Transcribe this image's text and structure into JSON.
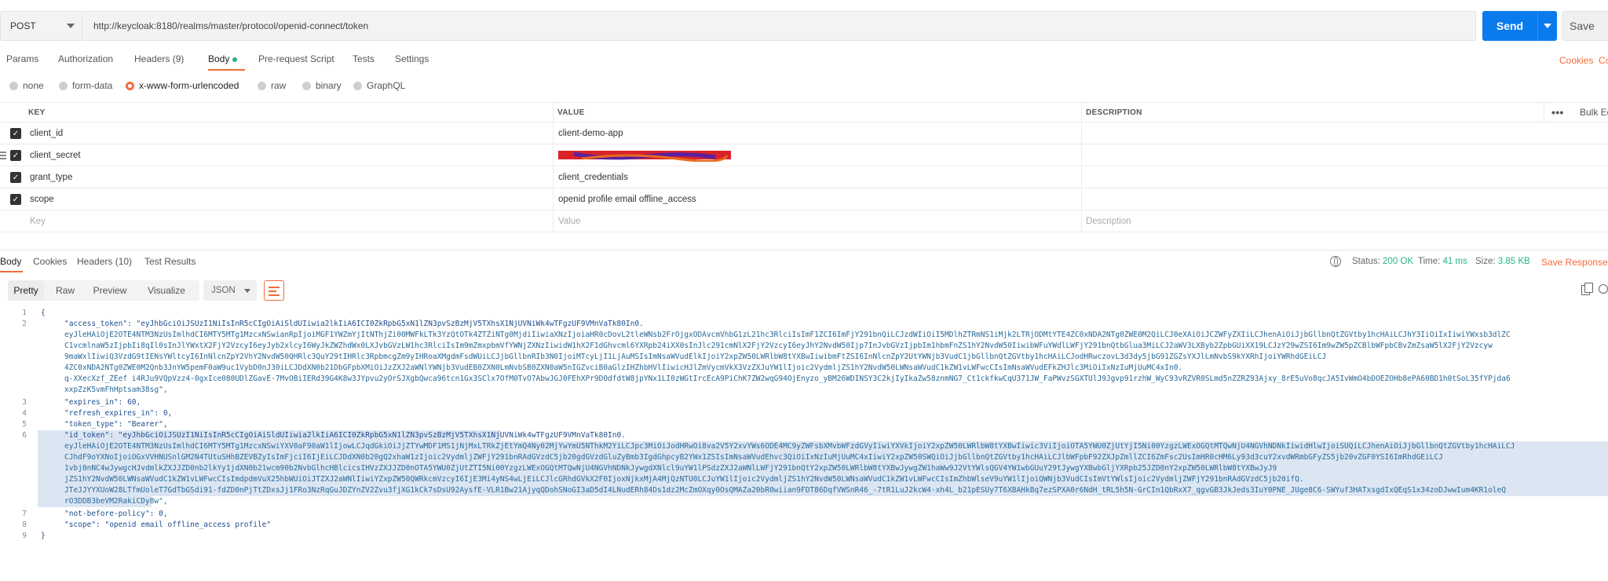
{
  "request": {
    "method": "POST",
    "url": "http://keycloak:8180/realms/master/protocol/openid-connect/token",
    "send_label": "Send",
    "save_label": "Save"
  },
  "request_tabs": {
    "params": "Params",
    "authorization": "Authorization",
    "headers": "Headers (9)",
    "body": "Body",
    "prerequest": "Pre-request Script",
    "tests": "Tests",
    "settings": "Settings",
    "cookies": "Cookies",
    "code": "Co"
  },
  "body_types": [
    "none",
    "form-data",
    "x-www-form-urlencoded",
    "raw",
    "binary",
    "GraphQL"
  ],
  "body_type_selected": "x-www-form-urlencoded",
  "params_table": {
    "headers": {
      "key": "KEY",
      "value": "VALUE",
      "description": "DESCRIPTION",
      "more": "•••",
      "bulk_edit": "Bulk Ed"
    },
    "rows": [
      {
        "key": "client_id",
        "value": "client-demo-app",
        "checked": true
      },
      {
        "key": "client_secret",
        "value": "",
        "checked": true,
        "redacted": true
      },
      {
        "key": "grant_type",
        "value": "client_credentials",
        "checked": true
      },
      {
        "key": "scope",
        "value": "openid profile email offline_access",
        "checked": true
      }
    ],
    "placeholder": {
      "key": "Key",
      "value": "Value",
      "description": "Description"
    }
  },
  "response_tabs": {
    "body": "Body",
    "cookies": "Cookies",
    "headers": "Headers (10)",
    "test_results": "Test Results"
  },
  "response_status": {
    "status_label": "Status:",
    "status_value": "200 OK",
    "time_label": "Time:",
    "time_value": "41 ms",
    "size_label": "Size:",
    "size_value": "3.85 KB",
    "save_response": "Save Response"
  },
  "view_bar": {
    "modes": [
      "Pretty",
      "Raw",
      "Preview",
      "Visualize"
    ],
    "selected": "Pretty",
    "format": "JSON"
  },
  "code_lines": [
    {
      "n": "1",
      "text": "{"
    },
    {
      "n": "2",
      "text": "\"access_token\": \"eyJhbGciOiJSUzI1NiIsInR5cCIgOiAiSldUIiwia2lkIiA6ICI0ZkRpbG5xN1lZN3pvSzBzMjV5TXhsX1NjUVNiWk4wTFgzUF9VMnVaTk80In0."
    },
    {
      "n": "",
      "text": "eyJleHAiOjE2OTE4NTM3NzUsImlhdCI6MTY5MTg1MzcxNSwianRpIjoiMGF1YWZmYjItNThjZi00MWFkLTk3YzQtOTk4ZTZiNTg0MjdiIiwiaXNzIjoiaHR0cDovL2tleWNsb2FrOjgxODAvcmVhbG1zL21hc3RlciIsImF1ZCI6ImFjY291bnQiLCJzdWIiOiI5MDlhZTRmNS1iMjk2LTRjODMtYTE4ZC0xNDA2NTg0ZWE0M2QiLCJ0eXAiOiJCZWFyZXIiLCJhenAiOiJjbGllbnQtZGVtby1hcHAiLCJhY3IiOiIxIiwiYWxsb3dlZC"
    },
    {
      "n": "",
      "text": "C1vcmlnaW5zIjpbIi8qIl0sInJlYWxtX2FjY2VzcyI6eyJyb2xlcyI6WyJkZWZhdWx0LXJvbGVzLW1hc3RlciIsIm9mZmxpbmVfYWNjZXNzIiwidW1hX2F1dGhvcml6YXRpb24iXX0sInJlc291cmNlX2FjY2VzcyI6eyJhY2NvdW50Ijp7InJvbGVzIjpbIm1hbmFnZS1hY2NvdW50IiwibWFuYWdlLWFjY291bnQtbGlua3MiLCJ2aWV3LXByb2ZpbGUiXX19LCJzY29wZSI6Im9wZW5pZCBlbWFpbCBvZmZsaW5lX2FjY2Vzcyw"
    },
    {
      "n": "",
      "text": "9maWxlIiwiQ3VzdG9tIENsYWltcyI6InNlcnZpY2VhY2NvdW50QHRlc3QuY29tIHRlc3RpbmcgZm9yIHRoaXMgdmFsdWUiLCJjbGllbnRIb3N0IjoiMTcyLjI1LjAuMSIsImNsaWVudElkIjoiY2xpZW50LWRlbW8tYXBwIiwibmFtZSI6InNlcnZpY2UtYWNjb3VudC1jbGllbnQtZGVtby1hcHAiLCJodHRwczovL3d3dy5jbG91ZGZsYXJlLmNvbS9kYXRhIjoiYWRhdGEiLCJ"
    },
    {
      "n": "",
      "text": "4ZC0xNDA2NTg0ZWE0M2Qnb3JnYW5pemF0aW9uc1VybD0nJ30iLCJDdXN0b21DbGFpbXMiOiJzZXJ2aWNlYWNjb3VudEB0ZXN0LmNvbSB0ZXN0aW5nIGZvciB0aGlzIHZhbHVlIiwicHJlZmVycmVkX3VzZXJuYW1lIjoic2VydmljZS1hY2NvdW50LWNsaWVudC1kZW1vLWFwcCIsImNsaWVudEFkZHJlc3MiOiIxNzIuMjUuMC4xIn0."
    },
    {
      "n": "",
      "text": "q-XXecXzf_ZEef i4RJu9VQpVzz4-0gxIce080UDlZGavE-7MvOBiIERd39G4K8w3JYpvu2yOrSJXgbQwca96tcn1Gx3SClx7OfM0TvO7AbwJGJ0FEhXPr9DOdfdtW8jpYNx1LI0zWGtIrcEcA9PiChK7ZW2wqG94OjEnyzo_yBM26WDINSY3C2kjIyIkaZw58znmNG7_Ct1ckfkwCqU371JW_FaPWvzSGXTUlJ9Jgvp91rzhW_WyC93vRZVR0SLmd5nZZRZ93Ajxy_8rE5uVo8qcJA5IvWmO4bDOEZOHb8ePA60BD1h0tSoL35fYPjda6"
    },
    {
      "n": "",
      "text": "xxpZzK5vmFhHptsam38sg\","
    },
    {
      "n": "3",
      "text": "\"expires_in\": 60,"
    },
    {
      "n": "4",
      "text": "\"refresh_expires_in\": 0,"
    },
    {
      "n": "5",
      "text": "\"token_type\": \"Bearer\","
    },
    {
      "n": "6",
      "text": "\"id_token\": \"eyJhbGciOiJSUzI1NiIsInR5cCIgOiAiSldUIiwia2lkIiA6ICI0ZkRpbG5xN1lZN3pvSzBzMjV5TXhsX1NjUVNiWk4wTFgzUF9VMnVaTk80In0."
    },
    {
      "n": "",
      "text": "eyJleHAiOjE2OTE4NTM3NzUsImlhdCI6MTY5MTg1MzcxNSwiYXV0aF90aW1lIjowLCJqdGkiOiJjZTYwMDF1MS1jNjMxLTRkZjEtYmQ4Ny02MjYwYmU5NThkM2YiLCJpc3MiOiJodHRwOi8va2V5Y2xvYWs6ODE4MC9yZWFsbXMvbWFzdGVyIiwiYXVkIjoiY2xpZW50LWRlbW8tYXBwIiwic3ViIjoiOTA5YWU0ZjUtYjI5Ni00YzgzLWExOGQtMTQwNjU4NGVhNDNkIiwidHlwIjoiSUQiLCJhenAiOiJjbGllbnQtZGVtby1hcHAiLCJ"
    },
    {
      "n": "",
      "text": "CJhdF9oYXNoIjoiOGxVVHNUSnlGM2N4TUtuSHhBZEVBZyIsImFjciI6IjEiLCJDdXN0b20gQ2xhaW1zIjoic2VydmljZWFjY291bnRAdGVzdC5jb20gdGVzdGluZyBmb3IgdGhpcyB2YWx1ZSIsImNsaWVudEhvc3QiOiIxNzIuMjUuMC4xIiwiY2xpZW50SWQiOiJjbGllbnQtZGVtby1hcHAiLCJlbWFpbF92ZXJpZmllZCI6ZmFsc2UsImHR0cHM6Ly93d3cuY2xvdWRmbGFyZS5jb20vZGF0YSI6ImRhdGEiLCJ"
    },
    {
      "n": "",
      "text": "1vbj0nNC4wJywgcHJvdmlkZXJJZD0nb2lkYy1jdXN0b21wcm90b2NvbGlhcHBlcicsIHVzZXJJZD0nOTA5YWU0ZjUtZTI5Ni00YzgzLWExOGQtMTQwNjU4NGVhNDNkJywgdXNlcl9uYW1lPSdzZXJ2aWNlLWFjY291bnQtY2xpZW50LWRlbW8tYXBwJywgZW1haWw9J2VtYWlsQGV4YW1wbGUuY29tJywgYXBwbGljYXRpb25JZD0nY2xpZW50LWRlbW8tYXBwJyJ9"
    },
    {
      "n": "",
      "text": "jZS1hY2NvdW50LWNsaWVudC1kZW1vLWFwcCIsImdpdmVuX25hbWUiOiJTZXJ2aWNlIiwiYZxpZW50QWRkcmVzcyI6IjE3Mi4yNS4wLjEiLCJlcGRhdGVkX2F0IjoxNjkxMjA4MjQzNTU0LCJuYW1lIjoic2VydmljZS1hY2NvdW50LWNsaWVudC1kZW1vLWFwcCIsImZhbWlseV9uYW1lIjoiQWNjb3VudCIsImVtYWlsIjoic2VydmljZWFjY291bnRAdGVzdC5jb20ifQ."
    },
    {
      "n": "",
      "text": "JTeJJYYXUoW28LTfmUoleT7GdTbGSdi91-fdZD0nPjTtZDxsJj1FRo3NzRqGuJDZYnZV2Zvu3fjXG1kCk7sDsU92AysfE-VLR1Bw21AjyqQDohSNoGI3aD5dI4LNudERh84Ds1dz2McZmOXqy0OsQMAZa20bR0wiian9FDT86DqfVWSnR46_-7tR1LuJ2kcW4-xh4L_b21pESUy7T6XBAHkBq7ezSPXA0r6NdH_tRL5h5N-GrCIn1QbRxX7_qgvGB3JkJeds3IuY0PNE_JUge8C6-SWYuf3HATxsgdIxQEqS1x34zoDJwwIum4KR1oleQ"
    },
    {
      "n": "",
      "text": "rO3DDB3beVM2RakiCDy8w\","
    },
    {
      "n": "7",
      "text": "\"not-before-policy\": 0,"
    },
    {
      "n": "8",
      "text": "\"scope\": \"openid email offline_access profile\""
    },
    {
      "n": "9",
      "text": "}"
    }
  ],
  "colors": {
    "accent": "#f26b3a",
    "send": "#097bed",
    "status_ok": "#26b47f"
  }
}
